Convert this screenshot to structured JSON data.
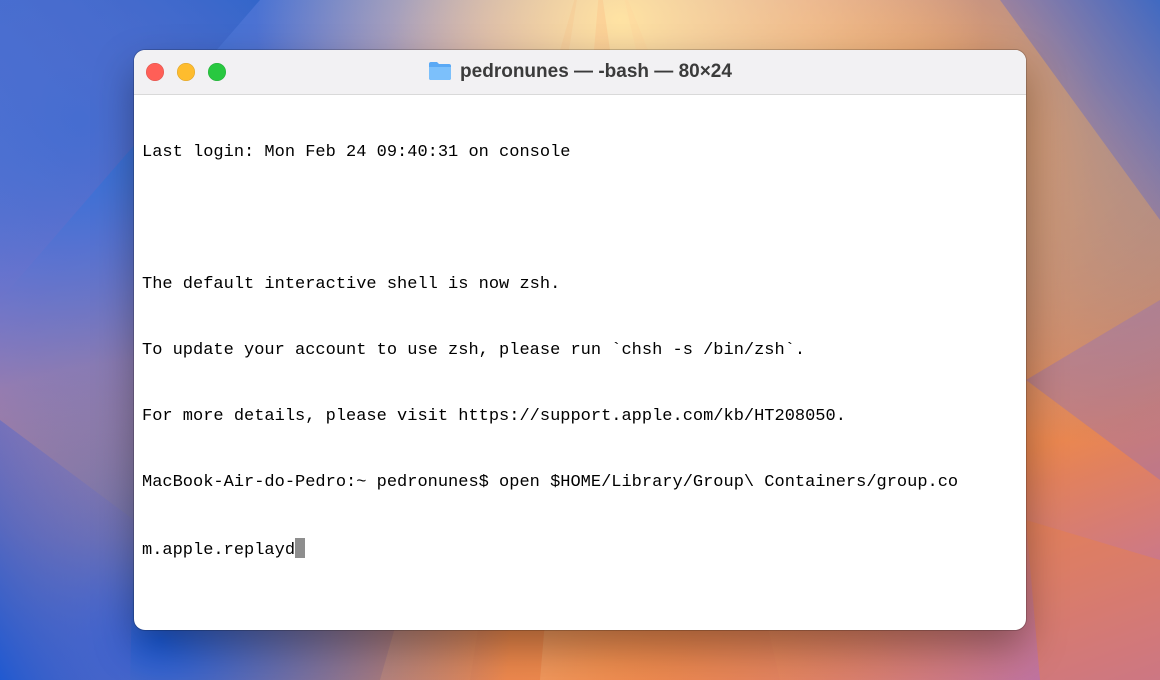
{
  "window": {
    "title": "pedronunes — -bash — 80×24",
    "folder_icon": "folder-icon"
  },
  "terminal": {
    "lines": [
      "Last login: Mon Feb 24 09:40:31 on console",
      "",
      "The default interactive shell is now zsh.",
      "To update your account to use zsh, please run `chsh -s /bin/zsh`.",
      "For more details, please visit https://support.apple.com/kb/HT208050.",
      "MacBook-Air-do-Pedro:~ pedronunes$ open $HOME/Library/Group\\ Containers/group.co",
      "m.apple.replayd"
    ]
  },
  "colors": {
    "close": "#ff5f57",
    "minimize": "#febc2e",
    "maximize": "#28c840",
    "folder": "#5aa9f5",
    "cursor": "#8e8e8e"
  }
}
